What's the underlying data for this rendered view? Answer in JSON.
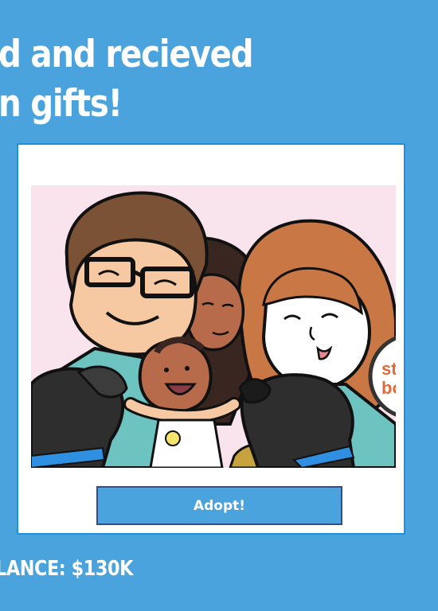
{
  "headline": {
    "line1": "d and recieved",
    "line2": "n gifts!"
  },
  "card": {
    "adopt_label": "Adopt!",
    "badge_line1": "st",
    "badge_line2": "bo"
  },
  "balance": {
    "text": "LANCE: $130K"
  },
  "colors": {
    "background": "#4aa3dd",
    "card_border": "#1e90e0",
    "button_border": "#2a4f92",
    "art_background": "#f9e3ec"
  }
}
